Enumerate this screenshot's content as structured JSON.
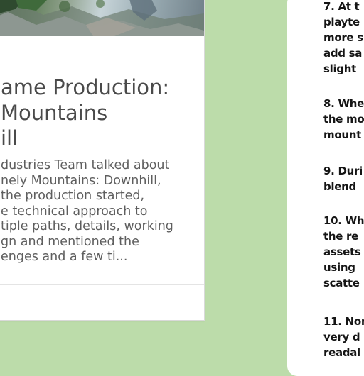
{
  "article": {
    "title": "ame Production:\n Mountains\nill",
    "excerpt": "dustries Team talked about\nnely Mountains: Downhill,\n the production started,\ne technical approach to\ntiple paths, details, working\ngn and mentioned the\nenges and a few ti..."
  },
  "doc": {
    "items": [
      "7. At t\nplayte\nmore s\nadd sa\nslight",
      "8. Whe\nthe mo\nmount",
      "9. Duri\nblend",
      "10. Wh\nthe re\nassets\nusing\nscatte",
      "11. Nor\nvery d\nreadal"
    ]
  },
  "colors": {
    "page_background": "#bcdcaa",
    "card_background": "#ffffff",
    "title_text": "#4a4a4a",
    "excerpt_text": "#5e5e5e",
    "doc_text": "#151515"
  }
}
